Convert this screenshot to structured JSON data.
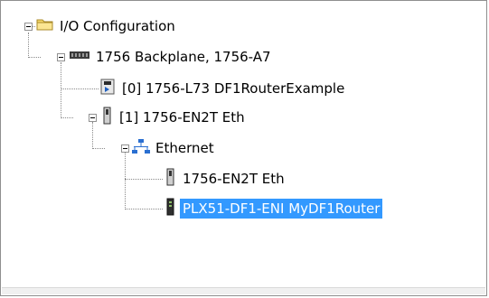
{
  "tree": {
    "root": {
      "label": "I/O Configuration",
      "icon": "folder-icon"
    },
    "backplane": {
      "label": "1756 Backplane, 1756-A7",
      "icon": "backplane-icon"
    },
    "controller": {
      "label": "[0] 1756-L73 DF1RouterExample",
      "icon": "controller-icon"
    },
    "enet_module": {
      "label": "[1] 1756-EN2T Eth",
      "icon": "module-icon"
    },
    "network": {
      "label": "Ethernet",
      "icon": "network-icon"
    },
    "children": [
      {
        "label": "1756-EN2T Eth",
        "icon": "module-icon",
        "selected": false
      },
      {
        "label": "PLX51-DF1-ENI MyDF1Router",
        "icon": "device-icon",
        "selected": true
      }
    ]
  },
  "colors": {
    "selection": "#3399ff",
    "selection_text": "#ffffff"
  }
}
